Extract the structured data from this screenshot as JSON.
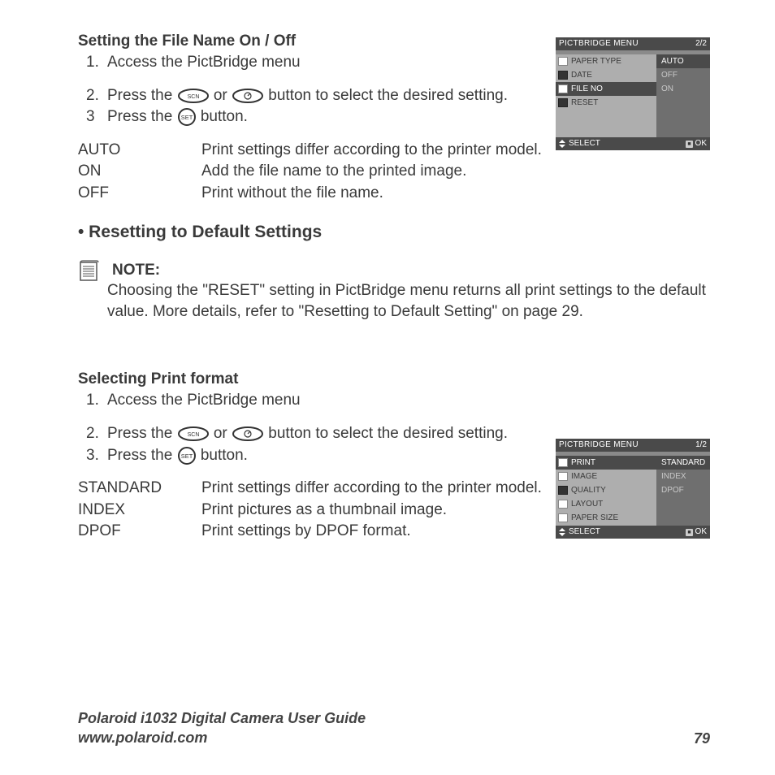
{
  "sec1": {
    "title": "Setting the File Name On / Off",
    "steps": {
      "s1": "Access the PictBridge menu",
      "s2a": "Press the ",
      "s2b": " or ",
      "s2c": " button to select the desired setting.",
      "s3a": "Press the ",
      "s3b": " button."
    },
    "defs": {
      "auto": {
        "term": "AUTO",
        "desc": "Print settings differ according to the printer model."
      },
      "on": {
        "term": "ON",
        "desc": "Add the file name to the printed image."
      },
      "off": {
        "term": "OFF",
        "desc": "Print without the file name."
      }
    }
  },
  "reset_heading": "• Resetting to Default Settings",
  "note": {
    "label": "NOTE:",
    "body": "Choosing the \"RESET\" setting in PictBridge menu returns all print settings to the default value. More details, refer to \"Resetting to Default Setting\" on page 29."
  },
  "sec2": {
    "title": "Selecting Print format",
    "steps": {
      "s1": "Access the PictBridge menu",
      "s2a": "Press the ",
      "s2b": " or ",
      "s2c": " button to select the desired setting.",
      "s3a": "Press the ",
      "s3b": " button."
    },
    "defs": {
      "standard": {
        "term": "STANDARD",
        "desc": "Print settings differ according to the printer model."
      },
      "index": {
        "term": "INDEX",
        "desc": "Print pictures as a thumbnail image."
      },
      "dpof": {
        "term": "DPOF",
        "desc": "Print settings by DPOF format."
      }
    }
  },
  "menu1": {
    "title": "PICTBRIDGE MENU",
    "page": "2/2",
    "left": [
      "PAPER TYPE",
      "DATE",
      "FILE NO",
      "RESET"
    ],
    "right": [
      "AUTO",
      "OFF",
      "ON"
    ],
    "select": "SELECT",
    "ok": "OK"
  },
  "menu2": {
    "title": "PICTBRIDGE MENU",
    "page": "1/2",
    "left": [
      "PRINT",
      "IMAGE",
      "QUALITY",
      "LAYOUT",
      "PAPER SIZE"
    ],
    "right": [
      "STANDARD",
      "INDEX",
      "DPOF"
    ],
    "select": "SELECT",
    "ok": "OK"
  },
  "footer": {
    "line1": "Polaroid i1032 Digital Camera User Guide",
    "line2": "www.polaroid.com",
    "page": "79"
  },
  "icons": {
    "scn": "SCN",
    "set": "SET"
  }
}
